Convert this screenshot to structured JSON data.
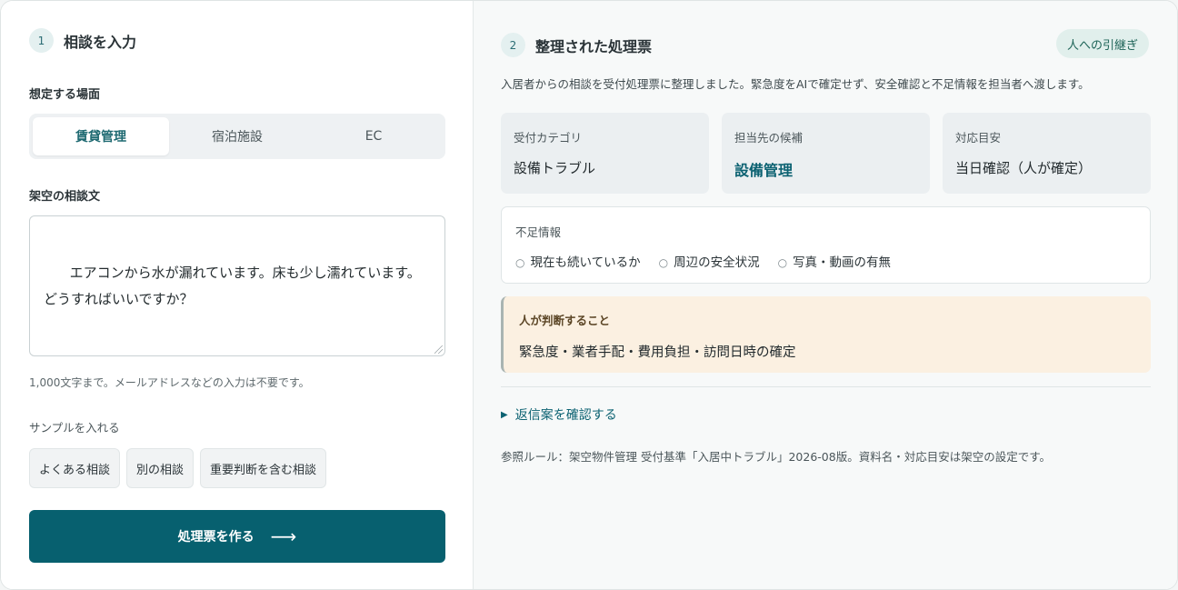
{
  "left": {
    "step_num": "1",
    "title": "相談を入力",
    "scene_label": "想定する場面",
    "scene_options": [
      "賃貸管理",
      "宿泊施設",
      "EC"
    ],
    "message_label": "架空の相談文",
    "message_value": "エアコンから水が漏れています。床も少し濡れています。\nどうすればいいですか？",
    "hint": "1,000文字まで。メールアドレスなどの入力は不要です。",
    "sample_label": "サンプルを入れる",
    "samples": [
      "よくある相談",
      "別の相談",
      "重要判断を含む相談"
    ],
    "submit_label": "処理票を作る",
    "submit_arrow": "⟶"
  },
  "right": {
    "step_num": "2",
    "title": "整理された処理票",
    "handoff_label": "人への引継ぎ",
    "description": "入居者からの相談を受付処理票に整理しました。緊急度をAIで確定せず、安全確認と不足情報を担当者へ渡します。",
    "cards": [
      {
        "label": "受付カテゴリ",
        "value": "設備トラブル"
      },
      {
        "label": "担当先の候補",
        "value": "設備管理"
      },
      {
        "label": "対応目安",
        "value": "当日確認（人が確定）"
      }
    ],
    "missing_title": "不足情報",
    "missing_items": [
      "現在も続いているか",
      "周辺の安全状況",
      "写真・動画の有無"
    ],
    "judge_title": "人が判断すること",
    "judge_text": "緊急度・業者手配・費用負担・訪問日時の確定",
    "details_label": "返信案を確認する",
    "reference": "参照ルール：架空物件管理 受付基準「入居中トラブル」2026-08版。資料名・対応目安は架空の設定です。"
  },
  "colors": {
    "accent": "#07606f",
    "handoff_bg": "#e1efec",
    "judge_bg": "#fbf0e1"
  }
}
